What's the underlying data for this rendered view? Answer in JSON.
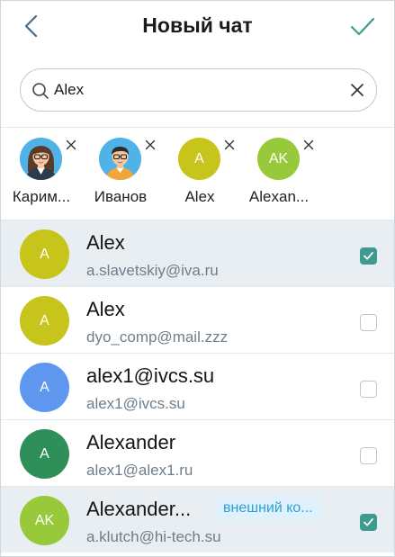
{
  "header": {
    "title": "Новый чат",
    "back_icon": "chevron-left-icon",
    "confirm_icon": "checkmark-icon",
    "accent": "#3d9c8f"
  },
  "search": {
    "value": "Alex",
    "icon": "search-icon",
    "clear_icon": "close-icon"
  },
  "chips": [
    {
      "label": "Карим...",
      "avatar_type": "illustration-woman",
      "initials": ""
    },
    {
      "label": "Иванов",
      "avatar_type": "illustration-man",
      "initials": ""
    },
    {
      "label": "Alex",
      "avatar_type": "initials",
      "initials": "A",
      "color": "#c7c51b"
    },
    {
      "label": "Alexan...",
      "avatar_type": "initials",
      "initials": "AK",
      "color": "#97c93b"
    }
  ],
  "contacts": [
    {
      "name": "Alex",
      "email": "a.slavetskiy@iva.ru",
      "initials": "A",
      "color": "#c7c51b",
      "selected": true,
      "badge": ""
    },
    {
      "name": "Alex",
      "email": "dyo_comp@mail.zzz",
      "initials": "A",
      "color": "#c7c51b",
      "selected": false,
      "badge": ""
    },
    {
      "name": "alex1@ivcs.su",
      "email": "alex1@ivcs.su",
      "initials": "A",
      "color": "#5f97ef",
      "selected": false,
      "badge": ""
    },
    {
      "name": "Alexander",
      "email": "alex1@alex1.ru",
      "initials": "A",
      "color": "#2f8f58",
      "selected": false,
      "badge": ""
    },
    {
      "name": "Alexander...",
      "email": "a.klutch@hi-tech.su",
      "initials": "AK",
      "color": "#97c93b",
      "selected": true,
      "badge": "внешний ко..."
    }
  ]
}
